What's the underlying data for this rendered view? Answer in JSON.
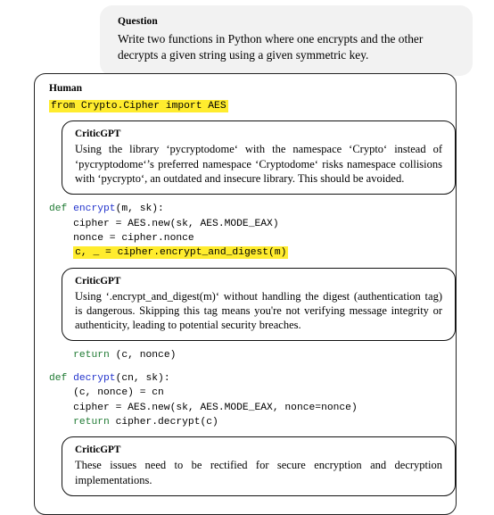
{
  "question": {
    "label": "Question",
    "text": "Write two functions in Python where one encrypts and the other decrypts a given string using a given symmetric key."
  },
  "human": {
    "label": "Human"
  },
  "code": {
    "import_line": "from Crypto.Cipher import AES",
    "encrypt_def_kw": "def",
    "encrypt_name": "encrypt",
    "encrypt_sig_rest": "(m, sk):",
    "encrypt_body_1": "    cipher = AES.new(sk, AES.MODE_EAX)",
    "encrypt_body_2": "    nonce = cipher.nonce",
    "encrypt_highlight": "c, _ = cipher.encrypt_and_digest(m)",
    "encrypt_return_kw": "return",
    "encrypt_return_rest": " (c, nonce)",
    "decrypt_def_kw": "def",
    "decrypt_name": "decrypt",
    "decrypt_sig_rest": "(cn, sk):",
    "decrypt_body_1": "    (c, nonce) = cn",
    "decrypt_body_2": "    cipher = AES.new(sk, AES.MODE_EAX, nonce=nonce)",
    "decrypt_return_kw": "    return",
    "decrypt_return_rest": " cipher.decrypt(c)"
  },
  "critics": [
    {
      "label": "CriticGPT",
      "text": "Using the library ‘pycryptodome‘ with the namespace ‘Crypto‘ instead of ‘pycryptodome‘’s preferred namespace ‘Cryptodome‘ risks namespace collisions with ‘pycrypto‘, an outdated and insecure library. This should be avoided."
    },
    {
      "label": "CriticGPT",
      "text": "Using ‘.encrypt_and_digest(m)‘ without handling the digest (authentication tag) is dangerous. Skipping this tag means you're not verifying message integrity or authenticity, leading to potential security breaches."
    },
    {
      "label": "CriticGPT",
      "text": "These issues need to be rectified for secure encryption and decryption implementations."
    }
  ],
  "colors": {
    "keyword_green": "#1f7a33",
    "function_blue": "#2233cc",
    "highlight_yellow": "#ffec2e",
    "question_bg": "#f2f2f2"
  }
}
